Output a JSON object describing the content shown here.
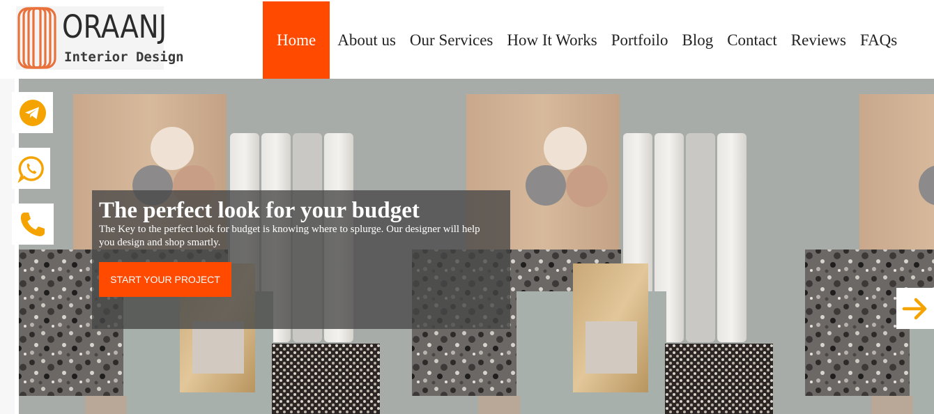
{
  "brand": {
    "name": "ORAANJ",
    "tagline": "Interior Design",
    "logo_color": "#e9713b"
  },
  "nav": {
    "items": [
      {
        "label": "Home",
        "active": true
      },
      {
        "label": "About us"
      },
      {
        "label": "Our Services"
      },
      {
        "label": "How It Works"
      },
      {
        "label": "Portfoilo"
      },
      {
        "label": "Blog"
      },
      {
        "label": "Contact"
      },
      {
        "label": "Reviews"
      },
      {
        "label": "FAQs"
      }
    ],
    "active_color": "#ff4a00"
  },
  "social": [
    {
      "icon": "telegram-icon",
      "color": "#f5a300"
    },
    {
      "icon": "whatsapp-icon",
      "color": "#f5a300"
    },
    {
      "icon": "phone-icon",
      "color": "#f5a300"
    }
  ],
  "hero": {
    "title": "The perfect look for your budget",
    "text": "The Key to the perfect look for budget is knowing where to splurge. Our designer will help you design and shop smartly.",
    "cta_label": "START YOUR PROJECT",
    "next_icon": "arrow-right-icon",
    "accent_color": "#ff4a00"
  }
}
